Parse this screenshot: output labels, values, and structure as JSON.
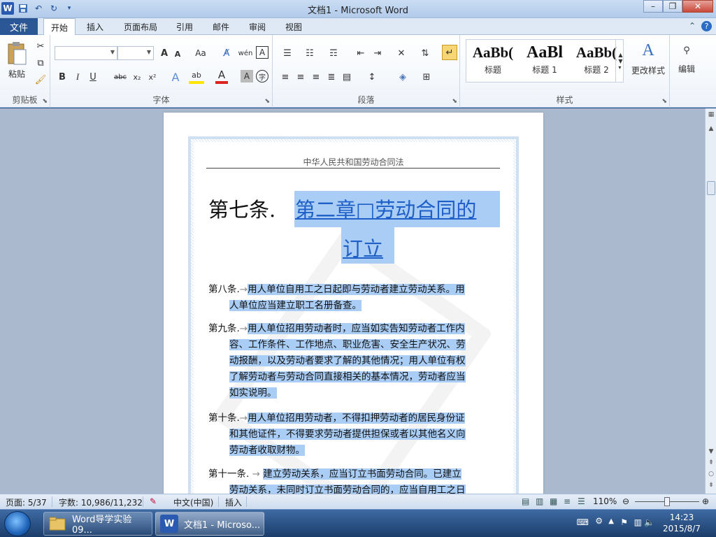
{
  "window": {
    "title": "文档1 - Microsoft Word",
    "app_icon": "W"
  },
  "tabs": {
    "file": "文件",
    "items": [
      "开始",
      "插入",
      "页面布局",
      "引用",
      "邮件",
      "审阅",
      "视图"
    ],
    "active": "开始"
  },
  "ribbon": {
    "groups": {
      "clipboard": "剪贴板",
      "font": "字体",
      "paragraph": "段落",
      "styles": "样式"
    },
    "paste_label": "粘贴",
    "font_name": "",
    "font_size": "",
    "grow_font": "A",
    "shrink_font": "A",
    "change_case": "Aa",
    "clear_format": "",
    "phonetic": "wén",
    "char_border": "A",
    "bold": "B",
    "italic": "I",
    "underline": "U",
    "strike": "abc",
    "subscript": "x₂",
    "superscript": "x²",
    "text_effects": "A",
    "highlight": "ab",
    "font_color": "A",
    "char_shading": "A",
    "enclose": "字",
    "styles": [
      {
        "sample": "AaBb(",
        "name": "标题"
      },
      {
        "sample": "AaBl",
        "name": "标题 1"
      },
      {
        "sample": "AaBb(",
        "name": "标题 2"
      }
    ],
    "change_styles": "更改样式",
    "edit_label": "编辑"
  },
  "document": {
    "header": "中华人民共和国劳动合同法",
    "chapter_article": "第七条.",
    "chapter_title_line1": "第二章□劳动合同的",
    "chapter_title_line2": "订立",
    "articles": [
      {
        "label": "第八条.",
        "lines": [
          "用人单位自用工之日起即与劳动者建立劳动关系。用",
          "人单位应当建立职工名册备查。"
        ]
      },
      {
        "label": "第九条.",
        "lines": [
          "用人单位招用劳动者时，应当如实告知劳动者工作内",
          "容、工作条件、工作地点、职业危害、安全生产状况、劳",
          "动报酬，以及劳动者要求了解的其他情况；用人单位有权",
          "了解劳动者与劳动合同直接相关的基本情况，劳动者应当",
          "如实说明。"
        ]
      },
      {
        "label": "第十条.",
        "lines": [
          "用人单位招用劳动者，不得扣押劳动者的居民身份证",
          "和其他证件，不得要求劳动者提供担保或者以其他名义向",
          "劳动者收取财物。"
        ]
      },
      {
        "label": "第十一条.",
        "lines": [
          "建立劳动关系，应当订立书面劳动合同。已建立",
          "劳动关系，未同时订立书面劳动合同的，应当自用工之日"
        ]
      }
    ]
  },
  "statusbar": {
    "page": "页面: 5/37",
    "words": "字数: 10,986/11,232",
    "language": "中文(中国)",
    "mode": "插入",
    "zoom": "110%"
  },
  "taskbar": {
    "tasks": [
      {
        "label": "Word导学实验09...",
        "icon": "folder-icon"
      },
      {
        "label": "文档1 - Microso...",
        "icon": "word-icon"
      }
    ],
    "time": "14:23",
    "date": "2015/8/7"
  },
  "colors": {
    "selection": "#a9cdf5",
    "heading_link": "#1f5fc8",
    "file_tab": "#2b5797"
  }
}
